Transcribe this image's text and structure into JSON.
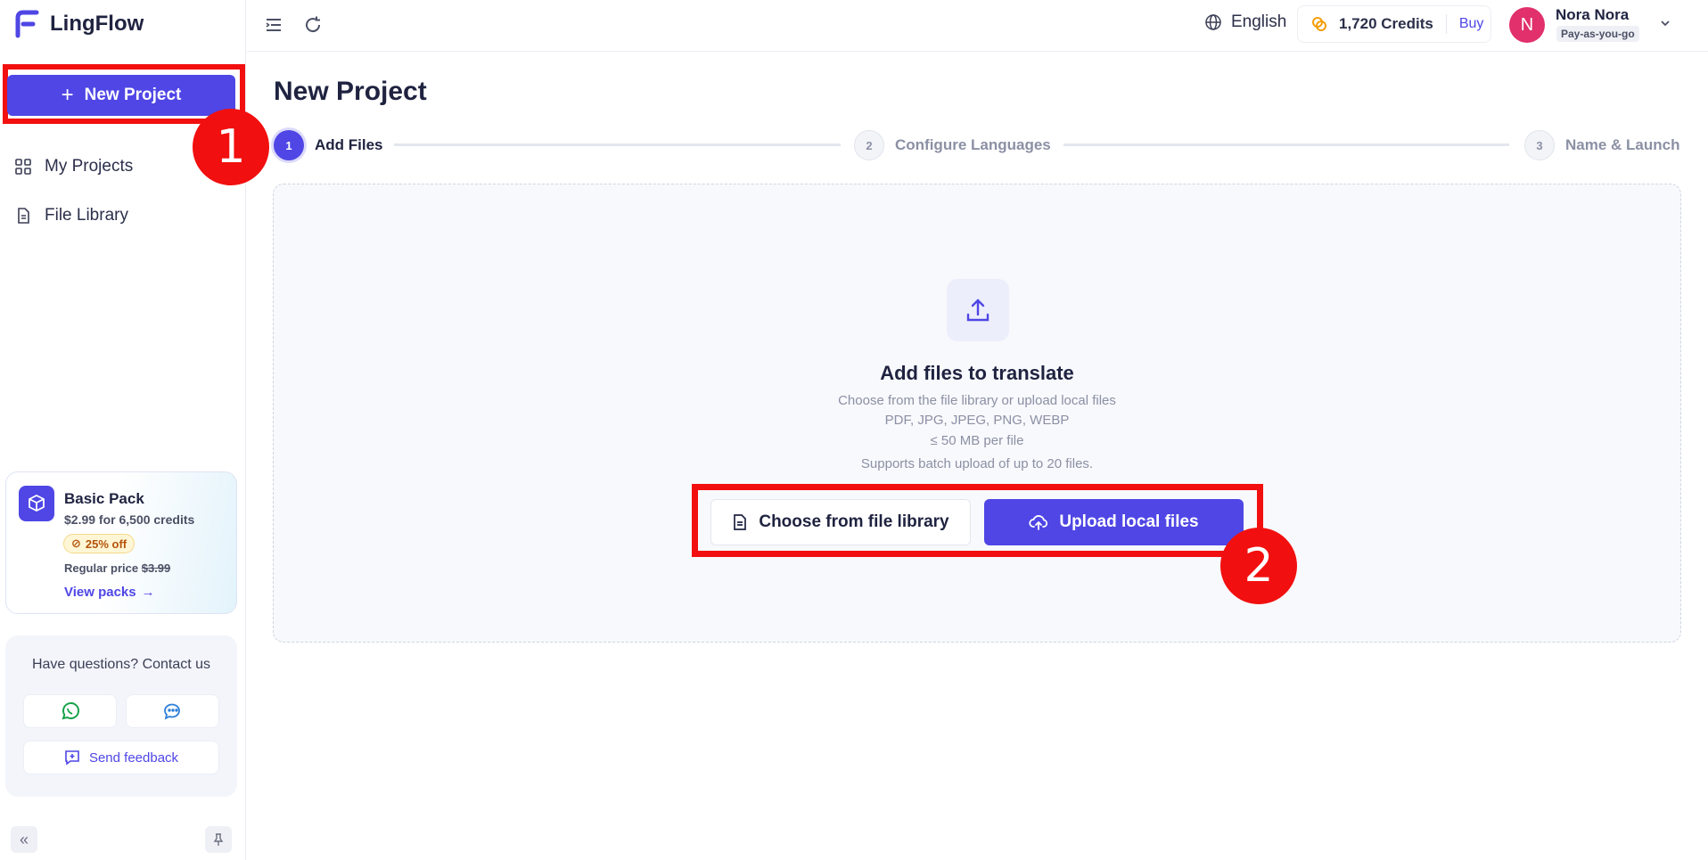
{
  "app": {
    "name": "LingFlow"
  },
  "sidebar": {
    "new_project_label": "New Project",
    "items": [
      {
        "label": "My Projects",
        "icon": "grid-icon"
      },
      {
        "label": "File Library",
        "icon": "file-icon"
      }
    ],
    "promo": {
      "title": "Basic Pack",
      "price": "$2.99 for 6,500 credits",
      "badge": "25% off",
      "regular_label": "Regular price",
      "regular_price": "$3.99",
      "link": "View packs"
    },
    "contact": {
      "title": "Have questions? Contact us",
      "feedback_label": "Send feedback"
    }
  },
  "header": {
    "language": "English",
    "credits": "1,720 Credits",
    "buy_label": "Buy",
    "user": {
      "initial": "N",
      "name": "Nora Nora",
      "plan": "Pay-as-you-go"
    }
  },
  "main": {
    "title": "New Project",
    "steps": [
      {
        "num": "1",
        "label": "Add Files",
        "state": "active"
      },
      {
        "num": "2",
        "label": "Configure Languages",
        "state": "idle"
      },
      {
        "num": "3",
        "label": "Name & Launch",
        "state": "idle"
      }
    ],
    "dropzone": {
      "title": "Add files to translate",
      "lines": [
        "Choose from the file library or upload local files",
        "PDF, JPG, JPEG, PNG, WEBP",
        "≤ 50 MB per file",
        "Supports batch upload of up to 20 files."
      ],
      "library_button": "Choose from file library",
      "upload_button": "Upload local files"
    }
  },
  "annotations": {
    "marker1": "1",
    "marker2": "2"
  },
  "colors": {
    "accent": "#4f46e5",
    "highlight": "#f20f0f",
    "avatar": "#e1306c"
  }
}
